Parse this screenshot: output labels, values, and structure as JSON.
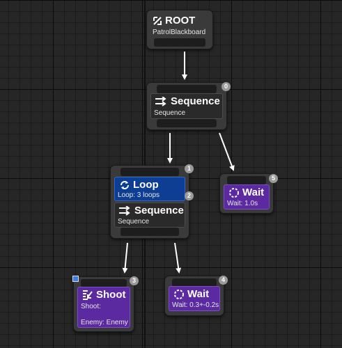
{
  "graph": {
    "root": {
      "title": "ROOT",
      "blackboard": "PatrolBlackboard"
    },
    "sequence_main": {
      "badge": "0",
      "title": "Sequence",
      "subtitle": "Sequence"
    },
    "loop_node": {
      "badge": "1",
      "loop": {
        "title": "Loop",
        "subtitle": "Loop: 3 loops"
      },
      "inner_badge": "2",
      "sequence": {
        "title": "Sequence",
        "subtitle": "Sequence"
      }
    },
    "wait_1": {
      "badge": "5",
      "title": "Wait",
      "subtitle": "Wait: 1.0s"
    },
    "shoot": {
      "badge": "3",
      "title": "Shoot",
      "line1": "Shoot:",
      "line2": "Enemy: Enemy"
    },
    "wait_2": {
      "badge": "4",
      "title": "Wait",
      "subtitle": "Wait: 0.3+-0.2s"
    }
  },
  "colors": {
    "composite_panel": "#2a2a2a",
    "decorator_blue": "#0d3e93",
    "task_purple": "#5b2aa0",
    "wire": "#ffffff"
  },
  "icons": {
    "root": "root-arrow-icon",
    "sequence": "sequence-arrows-icon",
    "loop": "loop-icon",
    "wait": "wait-circle-icon",
    "shoot": "shoot-icon"
  }
}
